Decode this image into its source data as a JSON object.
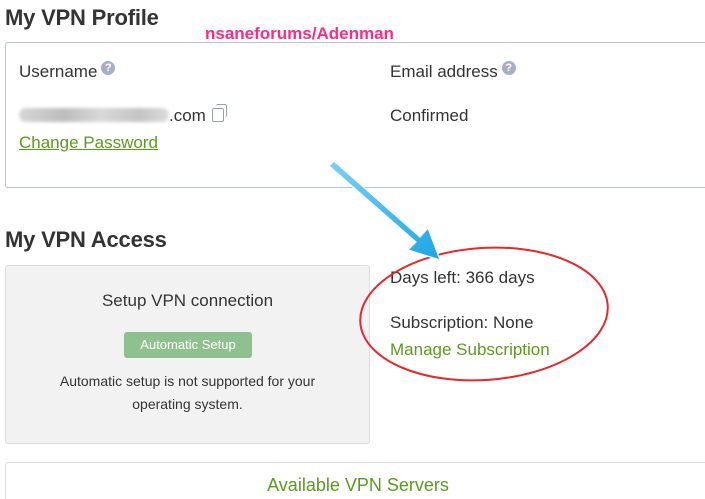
{
  "watermark": "nsaneforums/Adenman",
  "profile": {
    "title": "My VPN Profile",
    "username_label": "Username",
    "username_suffix": ".com",
    "email_label": "Email address",
    "email_status": "Confirmed",
    "change_password": "Change Password"
  },
  "access": {
    "title": "My VPN Access",
    "setup_title": "Setup VPN connection",
    "auto_setup_button": "Automatic Setup",
    "setup_note": "Automatic setup is not supported for your operating system.",
    "days_left": "Days left: 366 days",
    "subscription": "Subscription: None",
    "manage_subscription": "Manage Subscription"
  },
  "servers": {
    "link": "Available VPN Servers"
  },
  "icons": {
    "help": "help-icon",
    "copy": "copy-icon"
  },
  "colors": {
    "link": "#5b9a1f",
    "button": "#8fc18f",
    "watermark": "#ff2b83",
    "annotation_circle": "#e8262b",
    "annotation_arrow": "#1aa6e6"
  }
}
